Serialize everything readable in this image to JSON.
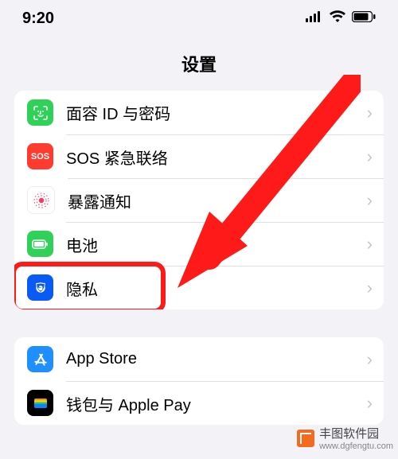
{
  "status": {
    "time": "9:20"
  },
  "page": {
    "title": "设置"
  },
  "groups": [
    {
      "items": [
        {
          "key": "faceid",
          "label": "面容 ID 与密码"
        },
        {
          "key": "sos",
          "label": "SOS 紧急联络"
        },
        {
          "key": "exposure",
          "label": "暴露通知"
        },
        {
          "key": "battery",
          "label": "电池"
        },
        {
          "key": "privacy",
          "label": "隐私"
        }
      ]
    },
    {
      "items": [
        {
          "key": "appstore",
          "label": "App Store"
        },
        {
          "key": "wallet",
          "label": "钱包与 Apple Pay"
        }
      ]
    }
  ],
  "annotation": {
    "arrow_target": "privacy",
    "highlight_target": "privacy"
  },
  "icons": {
    "sos_text": "SOS"
  },
  "watermark": {
    "name": "丰图软件园",
    "url": "www.dgfengtu.com"
  }
}
